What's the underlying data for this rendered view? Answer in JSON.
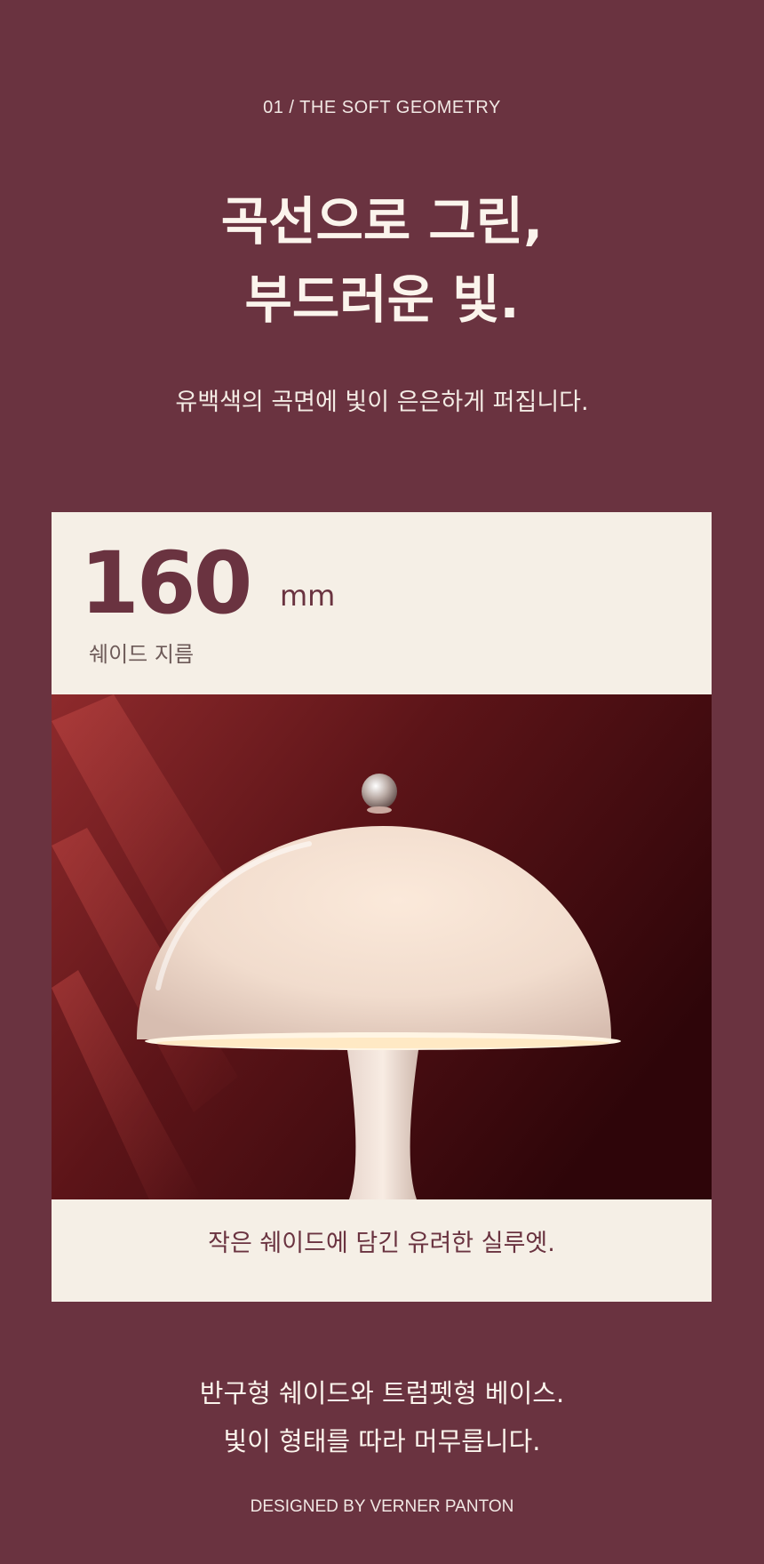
{
  "section": {
    "eyebrow": "01 / THE SOFT GEOMETRY",
    "headline_lines": [
      "곡선으로 그린,",
      "부드러운 빛."
    ],
    "subline": "유백색의 곡면에 빛이 은은하게 퍼집니다."
  },
  "spec_card": {
    "value": "160",
    "unit": "mm",
    "label": "쉐이드 지름",
    "caption": "작은 쉐이드에 담긴 유려한 실루엣."
  },
  "closing": {
    "lines": [
      "반구형 쉐이드와 트럼펫형 베이스.",
      "빛이 형태를 따라 머무릅니다."
    ],
    "credit": "DESIGNED BY VERNER PANTON"
  },
  "colors": {
    "background": "#6a3340",
    "card": "#f5efe6",
    "accent": "#6a3340"
  }
}
